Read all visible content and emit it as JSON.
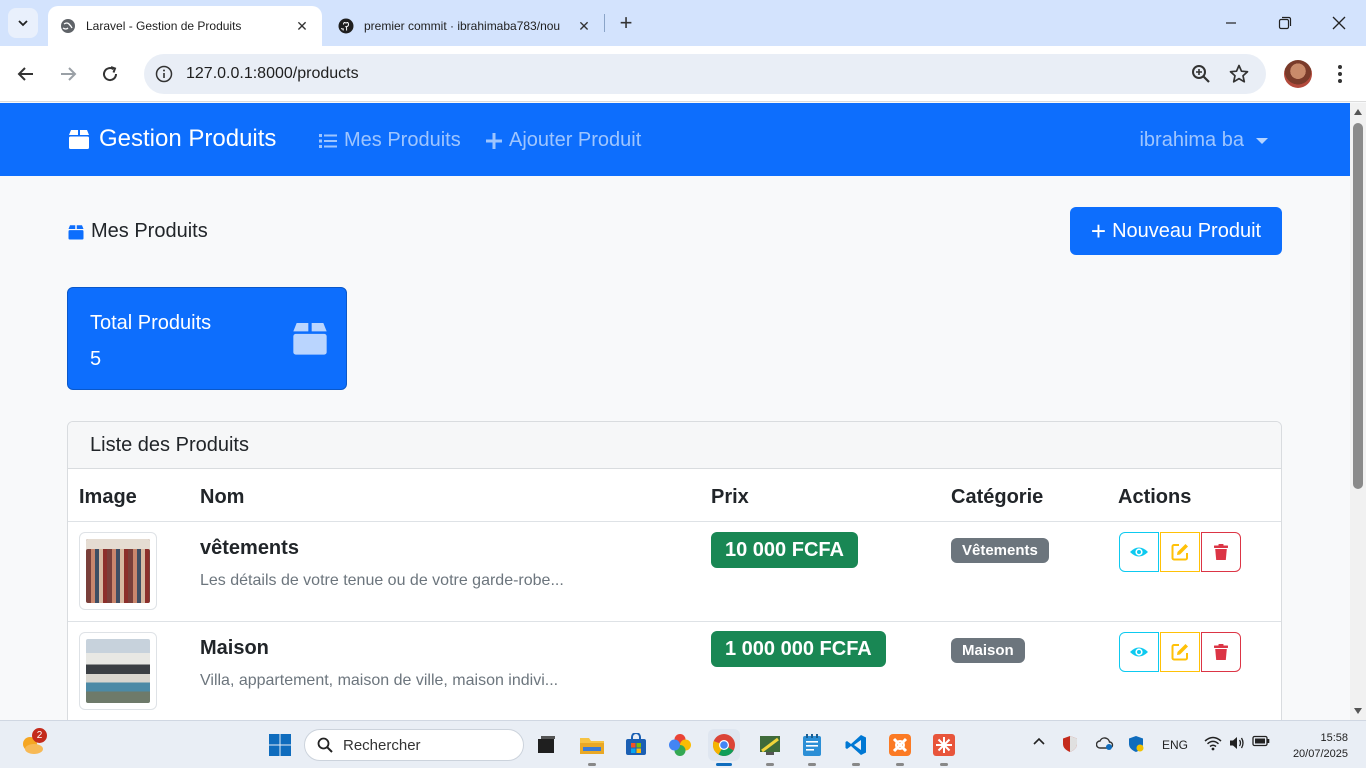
{
  "browser": {
    "tabs": [
      {
        "title": "Laravel - Gestion de Produits",
        "active": true
      },
      {
        "title": "premier commit · ibrahimaba783/nou",
        "active": false
      }
    ],
    "url": "127.0.0.1:8000/products"
  },
  "navbar": {
    "brand": "Gestion Produits",
    "links": [
      "Mes Produits",
      "Ajouter Produit"
    ],
    "user": "ibrahima ba"
  },
  "header": {
    "title": "Mes Produits",
    "new_button": "Nouveau Produit"
  },
  "stats": {
    "label": "Total Produits",
    "value": "5"
  },
  "products_card": {
    "title": "Liste des Produits",
    "columns": [
      "Image",
      "Nom",
      "Prix",
      "Catégorie",
      "Actions"
    ],
    "rows": [
      {
        "name": "vêtements",
        "description": "Les détails de votre tenue ou de votre garde-robe...",
        "price": "10 000 FCFA",
        "category": "Vêtements"
      },
      {
        "name": "Maison",
        "description": "Villa, appartement, maison de ville, maison indivi...",
        "price": "1 000 000 FCFA",
        "category": "Maison"
      }
    ]
  },
  "taskbar": {
    "search_placeholder": "Rechercher",
    "weather_badge": "2",
    "lang": "ENG",
    "time": "15:58",
    "date": "20/07/2025"
  },
  "colors": {
    "primary": "#0d6efd",
    "success": "#198754",
    "secondary": "#6c757d",
    "info": "#0dcaf0",
    "warning": "#ffc107",
    "danger": "#dc3545"
  }
}
